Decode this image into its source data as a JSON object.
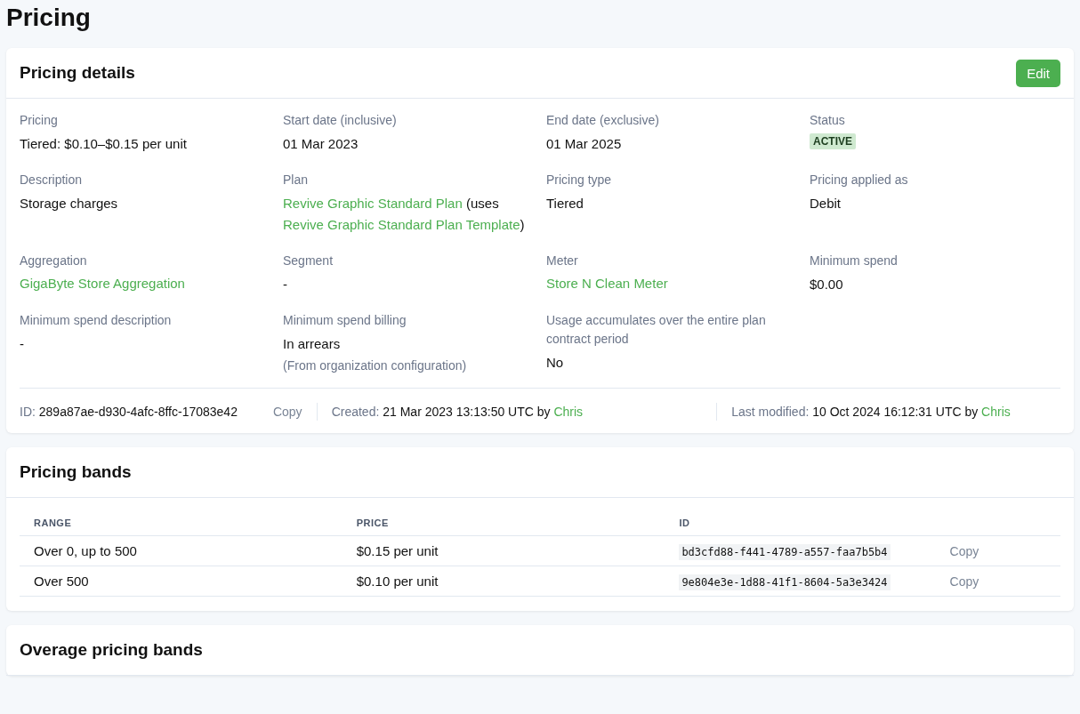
{
  "page_title": "Pricing",
  "details_card": {
    "title": "Pricing details",
    "edit_button": "Edit",
    "fields": [
      {
        "label": "Pricing",
        "kind": "text",
        "value": "Tiered: $0.10–$0.15 per unit"
      },
      {
        "label": "Start date (inclusive)",
        "kind": "text",
        "value": "01 Mar 2023"
      },
      {
        "label": "End date (exclusive)",
        "kind": "text",
        "value": "01 Mar 2025"
      },
      {
        "label": "Status",
        "kind": "badge",
        "value": "ACTIVE"
      },
      {
        "label": "Description",
        "kind": "text",
        "value": "Storage charges"
      },
      {
        "label": "Plan",
        "kind": "mixed",
        "parts": [
          {
            "text": "Revive Graphic Standard Plan",
            "link": true
          },
          {
            "text": " (uses ",
            "link": false
          },
          {
            "text": "Revive Graphic Standard Plan Template",
            "link": true
          },
          {
            "text": ")",
            "link": false
          }
        ]
      },
      {
        "label": "Pricing type",
        "kind": "text",
        "value": "Tiered"
      },
      {
        "label": "Pricing applied as",
        "kind": "text",
        "value": "Debit"
      },
      {
        "label": "Aggregation",
        "kind": "link",
        "value": "GigaByte Store Aggregation"
      },
      {
        "label": "Segment",
        "kind": "text",
        "value": "-"
      },
      {
        "label": "Meter",
        "kind": "link",
        "value": "Store N Clean Meter"
      },
      {
        "label": "Minimum spend",
        "kind": "text",
        "value": "$0.00"
      },
      {
        "label": "Minimum spend description",
        "kind": "text",
        "value": "-"
      },
      {
        "label": "Minimum spend billing",
        "kind": "text",
        "value": "In arrears",
        "note": "(From organization configuration)"
      },
      {
        "label": "Usage accumulates over the entire plan contract period",
        "kind": "text",
        "value": "No"
      }
    ],
    "footer": {
      "id_label": "ID:",
      "id_value": "289a87ae-d930-4afc-8ffc-17083e42",
      "copy": "Copy",
      "created": {
        "label": "Created:",
        "value": "21 Mar 2023 13:13:50 UTC by",
        "user": "Chris"
      },
      "modified": {
        "label": "Last modified:",
        "value": "10 Oct 2024 16:12:31 UTC by",
        "user": "Chris"
      }
    }
  },
  "bands_card": {
    "title": "Pricing bands",
    "columns": [
      "RANGE",
      "PRICE",
      "ID"
    ],
    "rows": [
      {
        "range": "Over 0, up to 500",
        "price": "$0.15 per unit",
        "id": "bd3cfd88-f441-4789-a557-faa7b5b4",
        "copy": "Copy"
      },
      {
        "range": "Over 500",
        "price": "$0.10 per unit",
        "id": "9e804e3e-1d88-41f1-8604-5a3e3424",
        "copy": "Copy"
      }
    ]
  },
  "overage_card": {
    "title": "Overage pricing bands"
  }
}
